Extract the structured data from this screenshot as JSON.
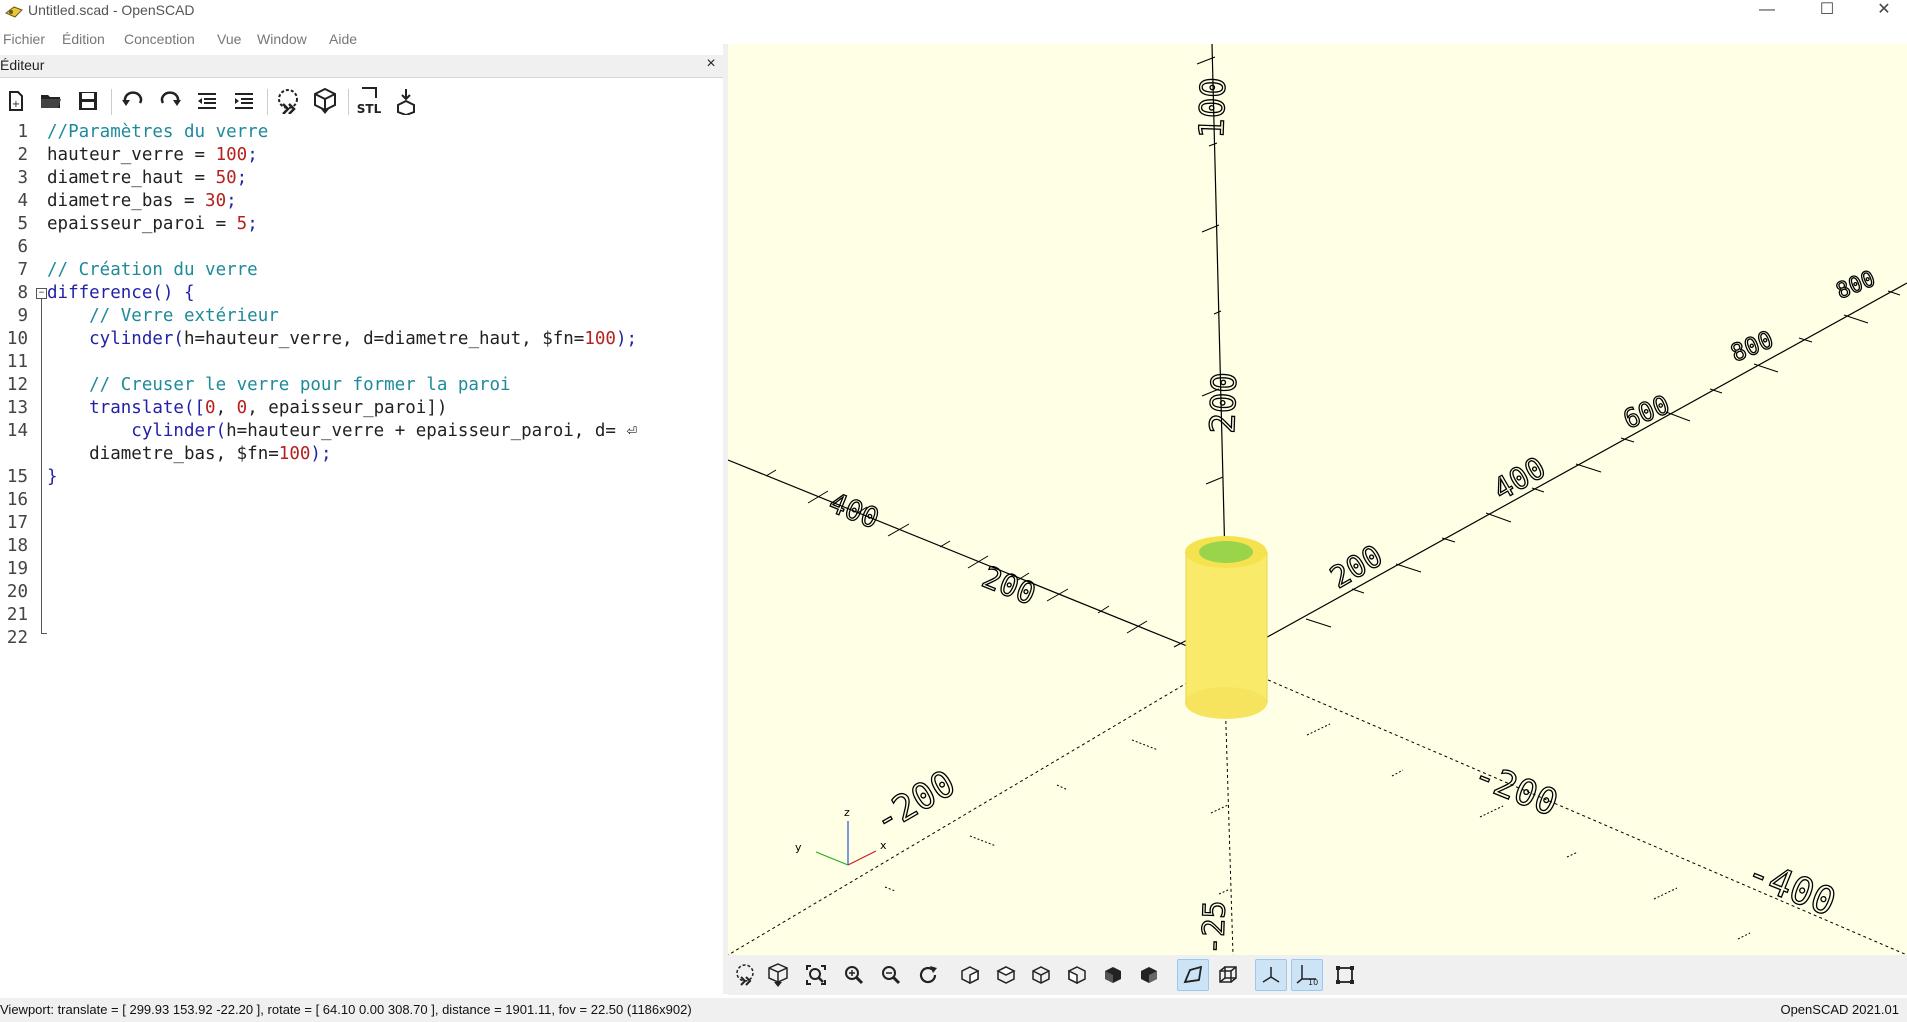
{
  "window": {
    "title": "Untitled.scad - OpenSCAD",
    "minimize": "—",
    "maximize": "☐",
    "close": "✕"
  },
  "menu": [
    "Fichier",
    "Édition",
    "Conception",
    "Vue",
    "Window",
    "Aide"
  ],
  "editor": {
    "title": "Éditeur",
    "close": "×",
    "toolbar": [
      "new-file-icon",
      "open-file-icon",
      "save-icon",
      "undo-icon",
      "redo-icon",
      "unindent-icon",
      "indent-icon",
      "preview-icon",
      "render-icon",
      "export-stl-icon",
      "send-to-print-icon"
    ],
    "toolbar_stl_label": "STL",
    "lines": [
      {
        "n": "1",
        "tokens": [
          {
            "t": "//Paramètres du verre",
            "c": "comment"
          }
        ]
      },
      {
        "n": "2",
        "tokens": [
          {
            "t": "hauteur_verre = ",
            "c": "ident"
          },
          {
            "t": "100",
            "c": "num"
          },
          {
            "t": ";",
            "c": "kw"
          }
        ]
      },
      {
        "n": "3",
        "tokens": [
          {
            "t": "diametre_haut = ",
            "c": "ident"
          },
          {
            "t": "50",
            "c": "num"
          },
          {
            "t": ";",
            "c": "kw"
          }
        ]
      },
      {
        "n": "4",
        "tokens": [
          {
            "t": "diametre_bas = ",
            "c": "ident"
          },
          {
            "t": "30",
            "c": "num"
          },
          {
            "t": ";",
            "c": "kw"
          }
        ]
      },
      {
        "n": "5",
        "tokens": [
          {
            "t": "epaisseur_paroi = ",
            "c": "ident"
          },
          {
            "t": "5",
            "c": "num"
          },
          {
            "t": ";",
            "c": "kw"
          }
        ]
      },
      {
        "n": "6",
        "tokens": []
      },
      {
        "n": "7",
        "tokens": [
          {
            "t": "// Création du verre",
            "c": "comment"
          }
        ]
      },
      {
        "n": "8",
        "tokens": [
          {
            "t": "difference() {",
            "c": "kw"
          }
        ]
      },
      {
        "n": "9",
        "tokens": [
          {
            "t": "    // Verre extérieur",
            "c": "comment"
          }
        ]
      },
      {
        "n": "10",
        "tokens": [
          {
            "t": "    cylinder(",
            "c": "kw"
          },
          {
            "t": "h=hauteur_verre, d=diametre_haut, $fn=",
            "c": "ident"
          },
          {
            "t": "100",
            "c": "num"
          },
          {
            "t": ");",
            "c": "kw"
          }
        ]
      },
      {
        "n": "11",
        "tokens": []
      },
      {
        "n": "12",
        "tokens": [
          {
            "t": "    // Creuser le verre pour former la paroi",
            "c": "comment"
          }
        ]
      },
      {
        "n": "13",
        "tokens": [
          {
            "t": "    translate([",
            "c": "kw"
          },
          {
            "t": "0",
            "c": "num"
          },
          {
            "t": ", ",
            "c": "ident"
          },
          {
            "t": "0",
            "c": "num"
          },
          {
            "t": ", epaisseur_paroi])",
            "c": "ident"
          }
        ]
      },
      {
        "n": "14",
        "tokens": [
          {
            "t": "        cylinder(",
            "c": "kw"
          },
          {
            "t": "h=hauteur_verre + epaisseur_paroi, d= ",
            "c": "ident"
          },
          {
            "t": "⏎",
            "c": "ident"
          }
        ]
      },
      {
        "n": "",
        "tokens": [
          {
            "t": "    diametre_bas, $fn=",
            "c": "ident"
          },
          {
            "t": "100",
            "c": "num"
          },
          {
            "t": ");",
            "c": "kw"
          }
        ]
      },
      {
        "n": "15",
        "tokens": [
          {
            "t": "}",
            "c": "kw"
          }
        ]
      },
      {
        "n": "16",
        "tokens": []
      },
      {
        "n": "17",
        "tokens": []
      },
      {
        "n": "18",
        "tokens": []
      },
      {
        "n": "19",
        "tokens": []
      },
      {
        "n": "20",
        "tokens": []
      },
      {
        "n": "21",
        "tokens": []
      },
      {
        "n": "22",
        "tokens": []
      }
    ]
  },
  "viewport": {
    "background": "#ffffe5",
    "object_color": "#f9ea6a",
    "object_top_color": "#9ad44a",
    "axis_labels": {
      "z_top_a": "100",
      "z_top_b": "200",
      "x_pos": [
        "200",
        "400",
        "600",
        "800"
      ],
      "x_left": [
        "200",
        "400"
      ],
      "neg_front_left": "-200",
      "neg_front_right": [
        "-200",
        "-400"
      ],
      "neg_bottom": "-25"
    },
    "mini_axes": {
      "x": "x",
      "y": "y",
      "z": "z"
    }
  },
  "view_toolbar": [
    "preview-icon",
    "render-icon",
    "view-all-icon",
    "zoom-in-icon",
    "zoom-out-icon",
    "reset-view-icon",
    "view-right-icon",
    "view-top-icon",
    "view-bottom-icon",
    "view-left-icon",
    "view-front-icon",
    "view-back-icon",
    "perspective-icon",
    "orthogonal-icon",
    "show-axes-icon",
    "show-scale-icon",
    "show-edges-icon"
  ],
  "status": {
    "viewport": "Viewport: translate = [ 299.93 153.92 -22.20 ], rotate = [ 64.10 0.00 308.70 ], distance = 1901.11, fov = 22.50 (1186x902)",
    "version": "OpenSCAD 2021.01"
  }
}
